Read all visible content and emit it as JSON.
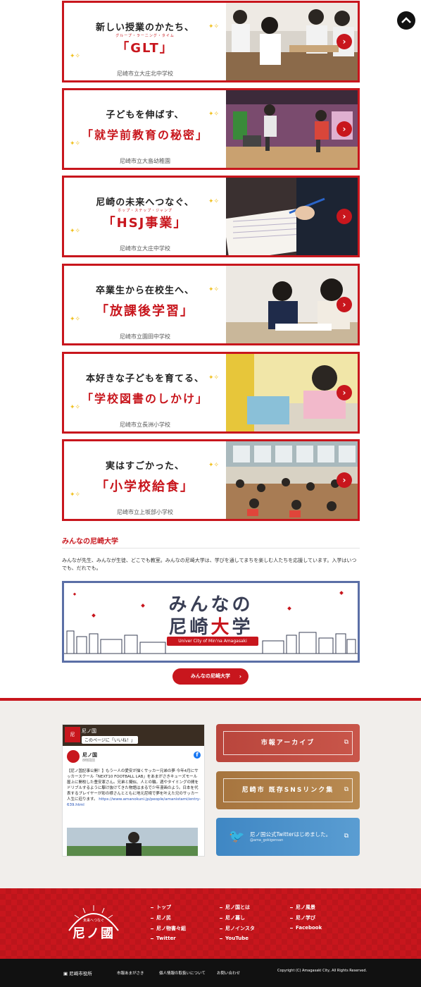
{
  "cards": [
    {
      "line1": "新しい授業のかたち、",
      "ruby": "グループ・ラーニング・タイム",
      "line2": "「GLT」",
      "school": "尼崎市立大庄北中学校"
    },
    {
      "line1": "子どもを伸ばす、",
      "ruby": "",
      "line2": "「就学前教育の秘密」",
      "school": "尼崎市立大島幼稚園"
    },
    {
      "line1": "尼崎の未来へつなぐ、",
      "ruby": "ホップ・ステップ・ジャンプ",
      "line2": "「HSJ事業」",
      "school": "尼崎市立大庄中学校"
    },
    {
      "line1": "卒業生から在校生へ、",
      "ruby": "",
      "line2": "「放課後学習」",
      "school": "尼崎市立園田中学校"
    },
    {
      "line1": "本好きな子どもを育てる、",
      "ruby": "",
      "line2": "「学校図書のしかけ」",
      "school": "尼崎市立長洲小学校"
    },
    {
      "line1": "実はすごかった、",
      "ruby": "",
      "line2": "「小学校給食」",
      "school": "尼崎市立上坂部小学校"
    }
  ],
  "section": {
    "title": "みんなの尼崎大学",
    "text": "みんなが先生、みんなが生徒、どこでも教室。みんなの尼崎大学は、学びを通してまちを楽しむ人たちを応援しています。入学はいつでも、だれでも。"
  },
  "banner": {
    "line1": "みんなの",
    "line2_a": "尼崎",
    "line2_b": "大",
    "line2_c": "学",
    "ribbon": "Univer City of Min'na Amagasaki"
  },
  "univ_button": "みんなの尼崎大学",
  "facebook": {
    "page_name": "尼ノ国",
    "like_label": "このページに「いいね！」",
    "post_name": "尼ノ国",
    "post_date": "8時間前",
    "post_body": "【尼ノ国記事公開！】もう一人の愛安が描くサッカー兄弟の夢 今年4月にサッカースクール「NEXT10 FOOTBALL LAB」をあまがさきキューズモール屋上に開校した豊安憲さん。兄弟と擬似、人との輪。週やタイミングの間をドリブルするように駆け抜けてきた物語はまるで少年漫画のよう。日本を代表するプレイヤーが彩の様さんとともに地元尼崎で夢を叶えた兄のサッカー人生に迫ります。",
    "post_link": "https://www.amanokuni.jp/people/amanistami/entry-639.html"
  },
  "side_buttons": [
    {
      "label": "市報アーカイブ"
    },
    {
      "label": "尼崎市 既存SNSリンク集"
    },
    {
      "label": "尼ノ国公式Twitterはじめました。",
      "sub": "@ama_gokigensan"
    }
  ],
  "footer": {
    "logo_top": "未来へつなぐ",
    "logo_main": "尼ノ國",
    "nav": [
      [
        "トップ",
        "尼ノ国とは",
        "尼ノ風景"
      ],
      [
        "尼ノ民",
        "尼ノ暮し",
        "尼ノ学び"
      ],
      [
        "尼ノ物書々組",
        "尼ノインスタ",
        "Facebook"
      ],
      [
        "Twitter",
        "YouTube",
        ""
      ]
    ]
  },
  "bottom": {
    "city": "尼崎市役所",
    "links": [
      "市報あまがさき",
      "個人情報の取扱いについて",
      "お問い合わせ"
    ],
    "copyright": "Copyright (C) Amagasaki City, All Rights Reserved."
  },
  "colors": {
    "brand_red": "#c8161d",
    "banner_blue": "#5b6fa6"
  }
}
